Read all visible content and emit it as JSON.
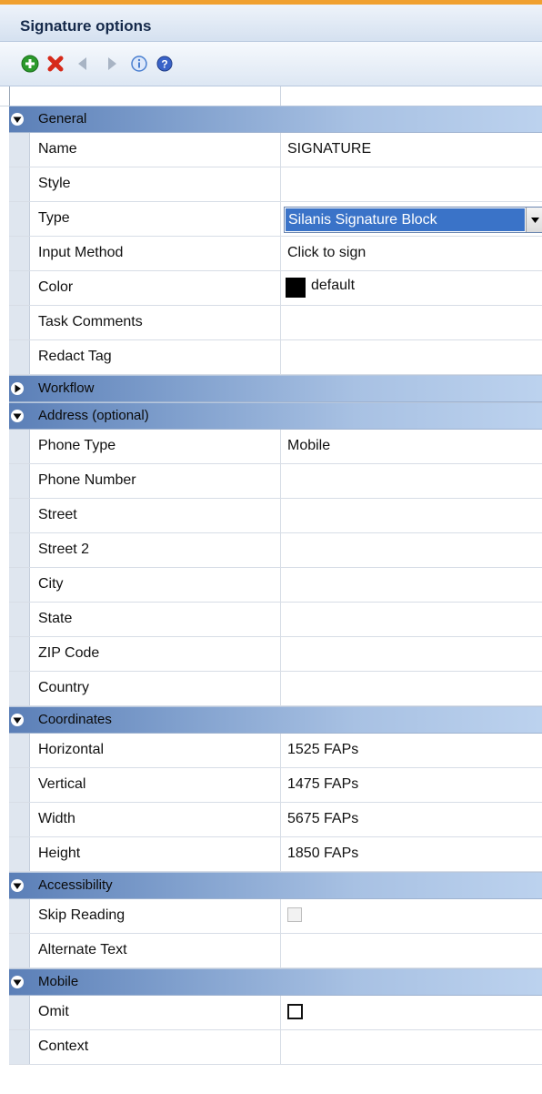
{
  "window": {
    "title": "Signature options"
  },
  "toolbar": {
    "buttons": [
      {
        "name": "add-icon",
        "color": "#2b9a2b"
      },
      {
        "name": "delete-icon",
        "color": "#d62a1a"
      },
      {
        "name": "back-icon",
        "color": "#a8b4c4"
      },
      {
        "name": "forward-icon",
        "color": "#a8b4c4"
      },
      {
        "name": "info-icon",
        "color": "#4a7fd0"
      },
      {
        "name": "help-icon",
        "color": "#3a63c8"
      }
    ]
  },
  "sections": {
    "general": {
      "label": "General",
      "name": {
        "label": "Name",
        "value": "SIGNATURE"
      },
      "style": {
        "label": "Style",
        "value": ""
      },
      "type": {
        "label": "Type",
        "value": "Silanis Signature Block"
      },
      "input_method": {
        "label": "Input Method",
        "value": "Click to sign"
      },
      "color": {
        "label": "Color",
        "value": "default",
        "swatch": "#000000"
      },
      "task_comments": {
        "label": "Task Comments",
        "value": ""
      },
      "redact_tag": {
        "label": "Redact Tag",
        "value": ""
      }
    },
    "workflow": {
      "label": "Workflow",
      "expanded": false
    },
    "address": {
      "label": "Address (optional)",
      "phone_type": {
        "label": "Phone Type",
        "value": "Mobile"
      },
      "phone_number": {
        "label": "Phone Number",
        "value": ""
      },
      "street": {
        "label": "Street",
        "value": ""
      },
      "street2": {
        "label": "Street 2",
        "value": ""
      },
      "city": {
        "label": "City",
        "value": ""
      },
      "state": {
        "label": "State",
        "value": ""
      },
      "zip": {
        "label": "ZIP Code",
        "value": ""
      },
      "country": {
        "label": "Country",
        "value": ""
      }
    },
    "coordinates": {
      "label": "Coordinates",
      "horizontal": {
        "label": "Horizontal",
        "value": "1525 FAPs"
      },
      "vertical": {
        "label": "Vertical",
        "value": "1475 FAPs"
      },
      "width": {
        "label": "Width",
        "value": "5675 FAPs"
      },
      "height": {
        "label": "Height",
        "value": "1850 FAPs"
      }
    },
    "accessibility": {
      "label": "Accessibility",
      "skip_reading": {
        "label": "Skip Reading",
        "checked": false,
        "enabled": false
      },
      "alternate_text": {
        "label": "Alternate Text",
        "value": ""
      }
    },
    "mobile": {
      "label": "Mobile",
      "omit": {
        "label": "Omit",
        "checked": false,
        "enabled": true
      },
      "context": {
        "label": "Context",
        "value": ""
      }
    }
  }
}
